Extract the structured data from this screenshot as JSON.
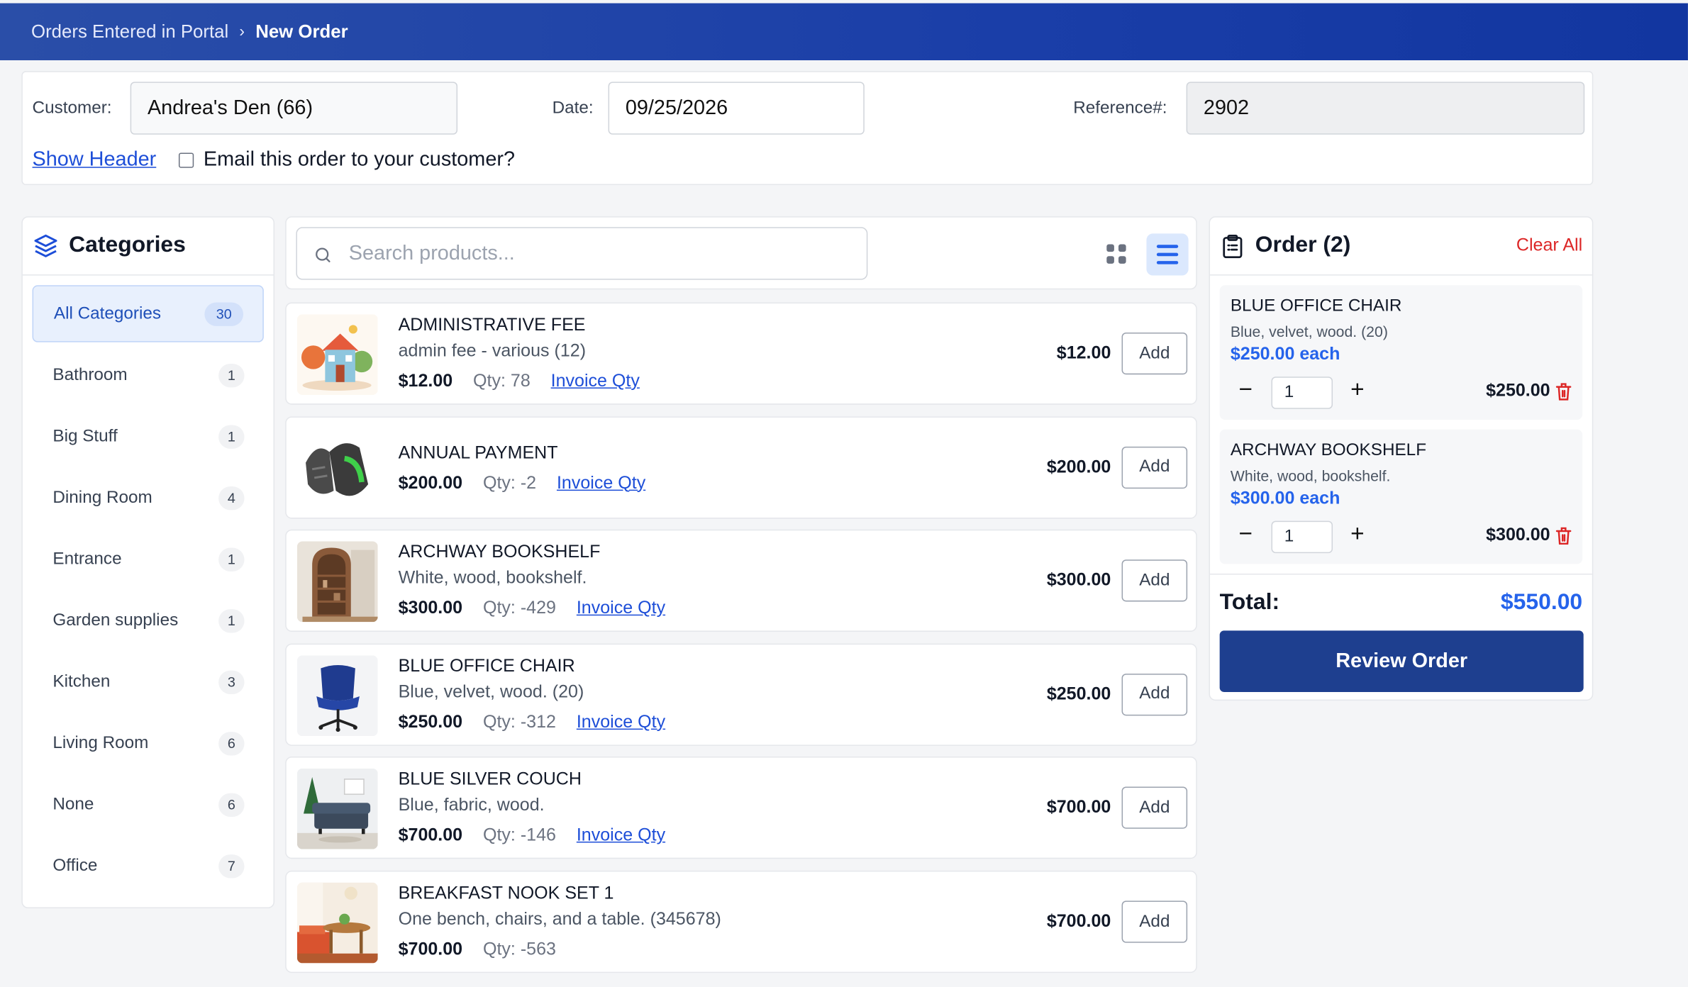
{
  "breadcrumb": {
    "parent": "Orders Entered in Portal",
    "separator": "›",
    "current": "New Order"
  },
  "header": {
    "customer_label": "Customer:",
    "customer_value": "Andrea's Den (66)",
    "date_label": "Date:",
    "date_value": "09/25/2026",
    "reference_label": "Reference#:",
    "reference_value": "2902",
    "show_header_link": "Show Header",
    "email_checkbox_label": "Email this order to your customer?",
    "email_checked": false
  },
  "categories": {
    "title": "Categories",
    "items": [
      {
        "label": "All Categories",
        "count": "30",
        "active": true
      },
      {
        "label": "Bathroom",
        "count": "1"
      },
      {
        "label": "Big Stuff",
        "count": "1"
      },
      {
        "label": "Dining Room",
        "count": "4"
      },
      {
        "label": "Entrance",
        "count": "1"
      },
      {
        "label": "Garden supplies",
        "count": "1"
      },
      {
        "label": "Kitchen",
        "count": "3"
      },
      {
        "label": "Living Room",
        "count": "6"
      },
      {
        "label": "None",
        "count": "6"
      },
      {
        "label": "Office",
        "count": "7"
      }
    ]
  },
  "search": {
    "placeholder": "Search products..."
  },
  "view_toggle": {
    "grid_icon": "grid-icon",
    "list_icon": "list-icon",
    "active": "list"
  },
  "products": [
    {
      "name": "ADMINISTRATIVE FEE",
      "desc": "admin fee - various (12)",
      "price": "$12.00",
      "qty": "Qty: 78",
      "link": "Invoice Qty",
      "right_price": "$12.00",
      "add": "Add"
    },
    {
      "name": "ANNUAL PAYMENT",
      "desc": "",
      "price": "$200.00",
      "qty": "Qty: -2",
      "link": "Invoice Qty",
      "right_price": "$200.00",
      "add": "Add"
    },
    {
      "name": "ARCHWAY BOOKSHELF",
      "desc": "White, wood, bookshelf.",
      "price": "$300.00",
      "qty": "Qty: -429",
      "link": "Invoice Qty",
      "right_price": "$300.00",
      "add": "Add"
    },
    {
      "name": "BLUE OFFICE CHAIR",
      "desc": "Blue, velvet, wood. (20)",
      "price": "$250.00",
      "qty": "Qty: -312",
      "link": "Invoice Qty",
      "right_price": "$250.00",
      "add": "Add"
    },
    {
      "name": "BLUE SILVER COUCH",
      "desc": "Blue, fabric, wood.",
      "price": "$700.00",
      "qty": "Qty: -146",
      "link": "Invoice Qty",
      "right_price": "$700.00",
      "add": "Add"
    },
    {
      "name": "BREAKFAST NOOK SET 1",
      "desc": "One bench, chairs, and a table. (345678)",
      "price": "$700.00",
      "qty": "Qty: -563",
      "link": "",
      "right_price": "$700.00",
      "add": "Add"
    }
  ],
  "order": {
    "title": "Order (2)",
    "clear_all": "Clear All",
    "items": [
      {
        "name": "BLUE OFFICE CHAIR",
        "desc": "Blue, velvet, wood. (20)",
        "each": "$250.00 each",
        "minus": "−",
        "qty": "1",
        "plus": "+",
        "line_total": "$250.00"
      },
      {
        "name": "ARCHWAY BOOKSHELF",
        "desc": "White, wood, bookshelf.",
        "each": "$300.00 each",
        "minus": "−",
        "qty": "1",
        "plus": "+",
        "line_total": "$300.00"
      }
    ],
    "total_label": "Total:",
    "total_value": "$550.00",
    "review_button": "Review Order"
  },
  "colors": {
    "topbar": "#1a3ea8",
    "accent": "#2563eb",
    "primary_button": "#1e3f8f",
    "danger": "#dc2626"
  }
}
